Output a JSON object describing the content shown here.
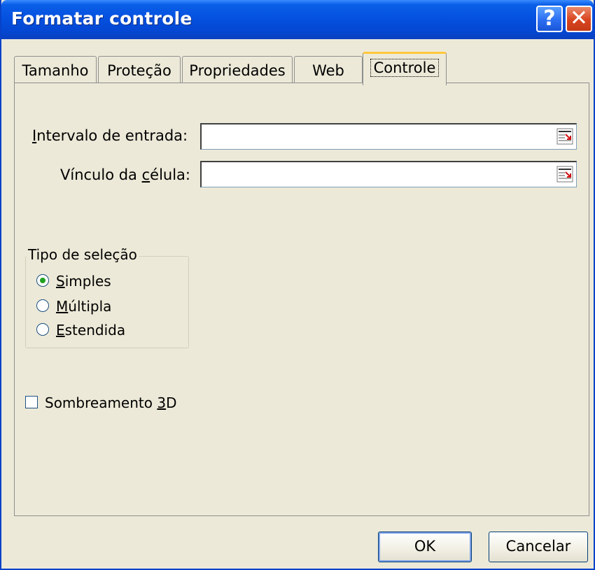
{
  "window": {
    "title": "Formatar controle"
  },
  "titlebar": {
    "help_icon": "help-icon",
    "help_glyph": "?",
    "close_icon": "close-icon",
    "close_glyph": "✕"
  },
  "tabs": [
    {
      "label": "Tamanho",
      "active": false
    },
    {
      "label": "Proteção",
      "active": false
    },
    {
      "label": "Propriedades",
      "active": false
    },
    {
      "label": "Web",
      "active": false
    },
    {
      "label": "Controle",
      "active": true
    }
  ],
  "fields": {
    "input_range": {
      "label_pre": "",
      "label_u": "I",
      "label_post": "ntervalo de entrada:",
      "value": ""
    },
    "cell_link": {
      "label_pre": "Vínculo da ",
      "label_u": "c",
      "label_post": "élula:",
      "value": ""
    },
    "ref_icon": "range-select-icon"
  },
  "selection_type": {
    "legend": "Tipo de seleção",
    "options": [
      {
        "u": "S",
        "rest": "imples",
        "checked": true
      },
      {
        "u": "M",
        "rest": "últipla",
        "checked": false
      },
      {
        "u": "E",
        "rest": "stendida",
        "checked": false
      }
    ]
  },
  "shading": {
    "label_pre": "Sombreamento ",
    "label_u": "3",
    "label_post": "D",
    "checked": false
  },
  "buttons": {
    "ok": "OK",
    "cancel": "Cancelar"
  },
  "colors": {
    "titlebar": "#0551e0",
    "dialog_bg": "#ECE9D8",
    "active_tab_accent": "#ffc83c",
    "radio_dot": "#21a121"
  }
}
